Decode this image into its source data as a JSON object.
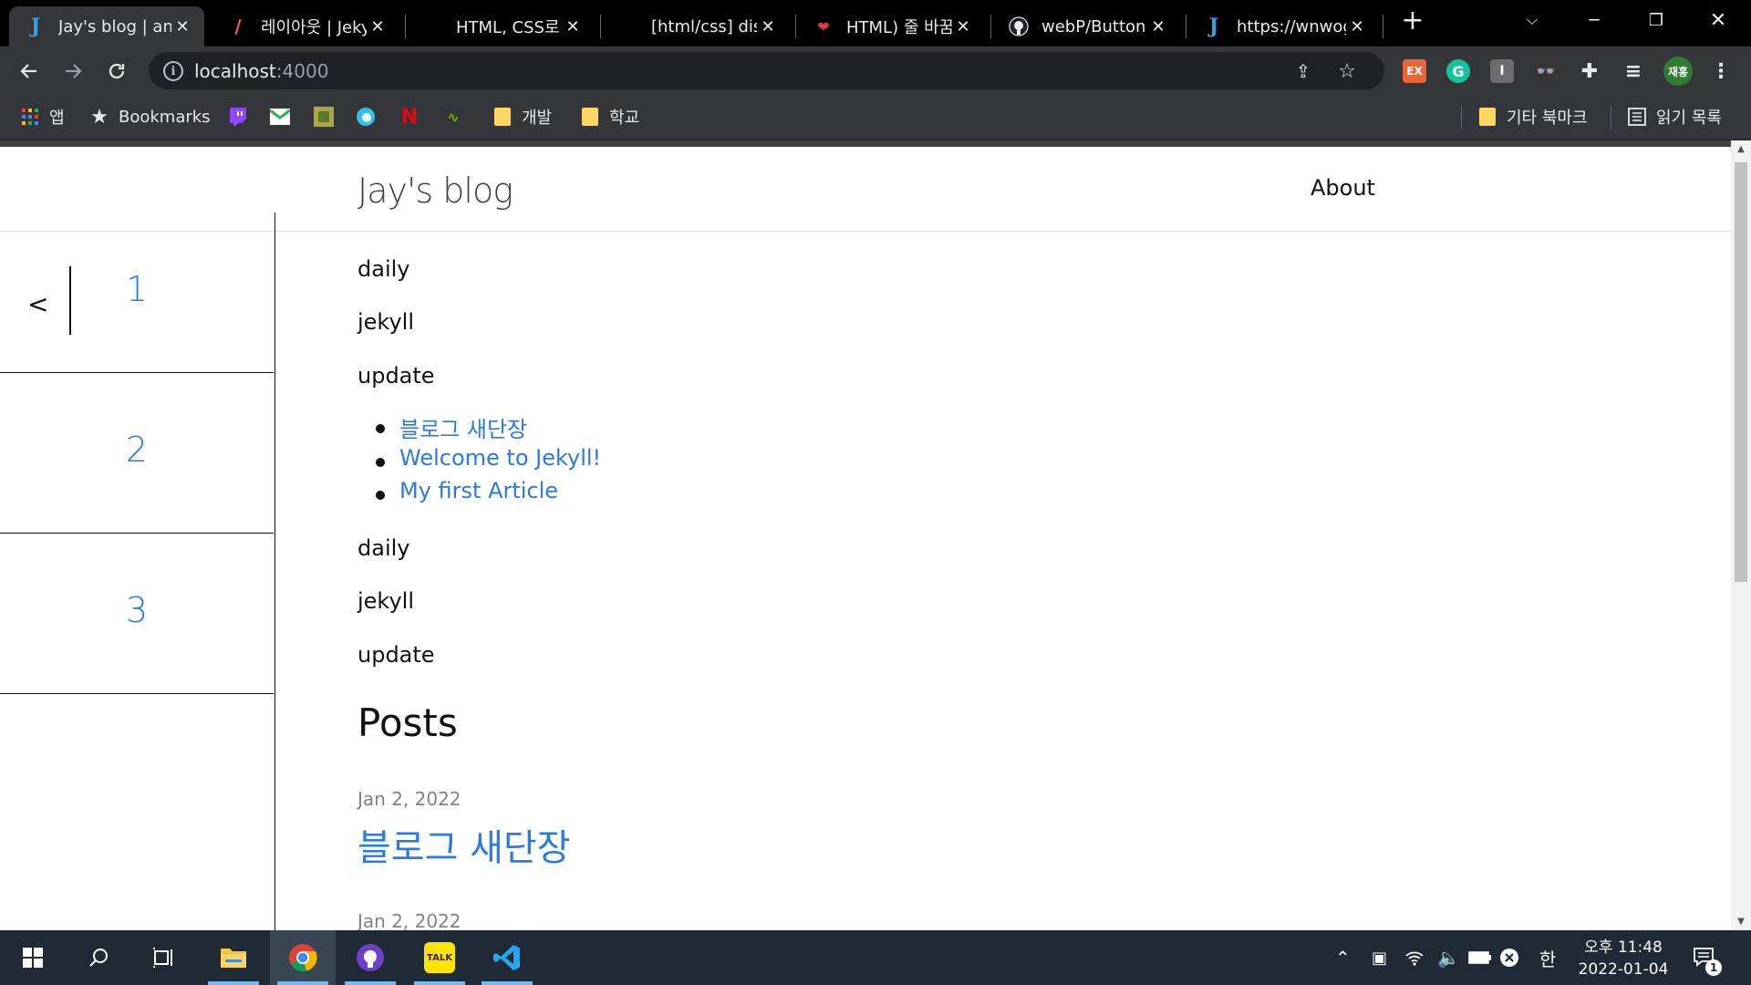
{
  "browser": {
    "tabs": [
      {
        "title": "Jay's blog | an",
        "icon": "jekyll-favicon"
      },
      {
        "title": "레이아웃 | Jeky",
        "icon": "quill-favicon"
      },
      {
        "title": "HTML, CSS로 ",
        "icon": "blank-favicon"
      },
      {
        "title": "[html/css] disp",
        "icon": "blank-favicon"
      },
      {
        "title": "HTML) 줄 바꿈",
        "icon": "red-heart-favicon"
      },
      {
        "title": "webP/Button.c",
        "icon": "github-favicon"
      },
      {
        "title": "https://wnwog",
        "icon": "jekyll-favicon"
      }
    ],
    "new_tab_label": "+",
    "url_host": "localhost",
    "url_port": ":4000",
    "bookmarks": [
      {
        "label": "앱",
        "icon": "apps-grid-icon"
      },
      {
        "label": "Bookmarks",
        "icon": "star-icon"
      },
      {
        "label": "개발",
        "icon": "folder-icon"
      },
      {
        "label": "학교",
        "icon": "folder-icon"
      }
    ],
    "other_bookmarks": "기타 북마크",
    "reading_list": "읽기 목록",
    "profile_initials": "재홍",
    "ext_ex_label": "EX"
  },
  "site": {
    "title": "Jay's blog",
    "nav_about": "About"
  },
  "pager": {
    "prev": "<",
    "pages": [
      "1",
      "2",
      "3"
    ]
  },
  "content": {
    "categories_top": [
      "daily",
      "jekyll",
      "update"
    ],
    "post_links": [
      "블로그 새단장",
      "Welcome to Jekyll!",
      "My first Article"
    ],
    "categories_bottom": [
      "daily",
      "jekyll",
      "update"
    ],
    "posts_heading": "Posts",
    "posts": [
      {
        "date": "Jan 2, 2022",
        "title": "블로그 새단장"
      },
      {
        "date": "Jan 2, 2022",
        "title": ""
      }
    ]
  },
  "taskbar": {
    "time": "오후 11:48",
    "date": "2022-01-04",
    "ime": "한",
    "notification_count": "1",
    "kakao_label": "TALK"
  },
  "colors": {
    "link": "#2a7ae2",
    "chrome_dark": "#35363a",
    "taskbar": "#1f2a36"
  }
}
